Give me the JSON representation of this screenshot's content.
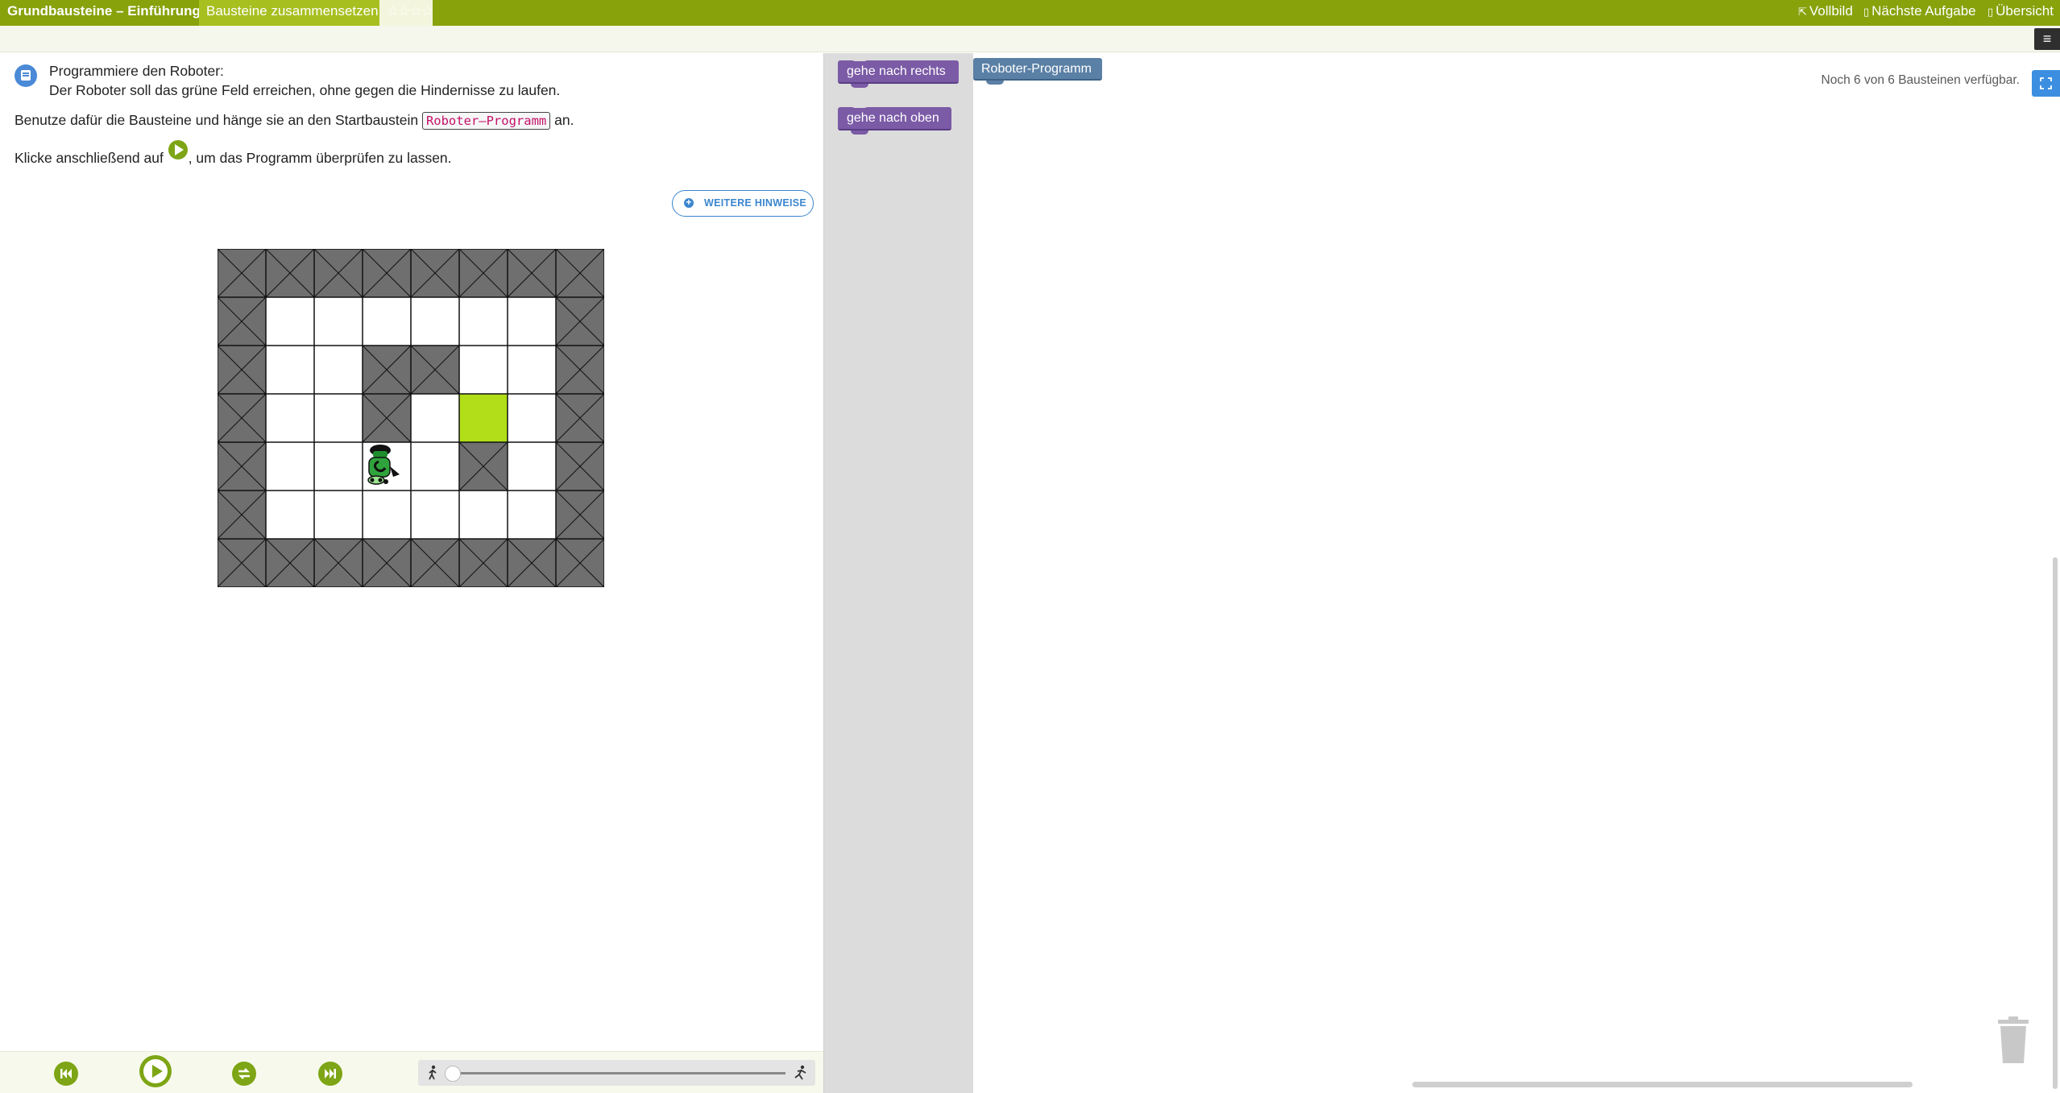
{
  "topbar": {
    "course": "Grundbausteine – Einführung",
    "task": "Bausteine zusammensetzen",
    "stars": "☆☆☆☆",
    "fullscreen": "Vollbild",
    "next_task": "Nächste Aufgabe",
    "overview": "Übersicht"
  },
  "task": {
    "line1": "Programmiere den Roboter:",
    "line2": "Der Roboter soll das grüne Feld erreichen, ohne gegen die Hindernisse zu laufen.",
    "line3_before": "Benutze dafür die Bausteine und hänge sie an den Startbaustein ",
    "line3_code": "Roboter–Programm",
    "line3_after": " an.",
    "line4_before": "Klicke anschließend auf ",
    "line4_after": ", um das Programm überprüfen zu lassen.",
    "hints_button": "WEITERE HINWEISE"
  },
  "grid": {
    "cols": 8,
    "rows": 7,
    "cells": [
      "WWWWWWWW",
      "W......W",
      "W..WW..W",
      "W..W.G.W",
      "W..R.W.W",
      "W......W",
      "WWWWWWWW"
    ],
    "legend": {
      "W": "wall",
      ".": "free",
      "G": "goal",
      "R": "robot"
    },
    "colors": {
      "wall": "#6f6f6f",
      "goal": "#b1de18",
      "robot": "#2fa33c"
    }
  },
  "controls": {
    "speed_level": 0.05
  },
  "toolbox": {
    "blocks": [
      "gehe nach rechts",
      "gehe nach oben"
    ]
  },
  "workspace": {
    "start_block": "Roboter-Programm",
    "remaining": "Noch 6 von 6 Bausteinen verfügbar."
  },
  "colors": {
    "topbar": "#88a20c",
    "accent_green": "#7da515",
    "move_block": "#7b5aa6",
    "start_block": "#5b80a5",
    "link_blue": "#3b86cf"
  }
}
